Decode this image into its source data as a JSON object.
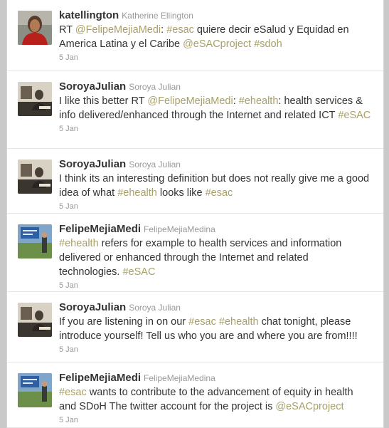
{
  "colors": {
    "link": "#a9a067",
    "text": "#333333",
    "meta": "#999999"
  },
  "tweets": [
    {
      "screen_name": "katellington",
      "full_name": "Katherine Ellington",
      "avatar": "avatar-woman-red-top",
      "segments": [
        {
          "t": "RT ",
          "link": false
        },
        {
          "t": "@FelipeMejiaMedi",
          "link": true
        },
        {
          "t": ": ",
          "link": false
        },
        {
          "t": "#esac",
          "link": true
        },
        {
          "t": " quiere decir eSalud y Equidad en America Latina y el Caribe ",
          "link": false
        },
        {
          "t": "@eSACproject",
          "link": true
        },
        {
          "t": " ",
          "link": false
        },
        {
          "t": "#sdoh",
          "link": true
        }
      ],
      "time": "5 Jan"
    },
    {
      "screen_name": "SoroyaJulian",
      "full_name": "Soroya Julian",
      "avatar": "avatar-sepia-desk",
      "segments": [
        {
          "t": "I like this better RT ",
          "link": false
        },
        {
          "t": "@FelipeMejiaMedi",
          "link": true
        },
        {
          "t": ": ",
          "link": false
        },
        {
          "t": "#ehealth",
          "link": true
        },
        {
          "t": ": health services & info delivered/enhanced through the Internet and related ICT ",
          "link": false
        },
        {
          "t": "#eSAC",
          "link": true
        }
      ],
      "time": "5 Jan"
    },
    {
      "screen_name": "SoroyaJulian",
      "full_name": "Soroya Julian",
      "avatar": "avatar-sepia-desk",
      "segments": [
        {
          "t": "I think its an interesting definition but does not really give me a good idea of what ",
          "link": false
        },
        {
          "t": "#ehealth",
          "link": true
        },
        {
          "t": " looks like ",
          "link": false
        },
        {
          "t": "#esac",
          "link": true
        }
      ],
      "time": "5 Jan"
    },
    {
      "screen_name": "FelipeMejiaMedi",
      "full_name": "FelipeMejiaMedina",
      "avatar": "avatar-outdoor-sign",
      "segments": [
        {
          "t": "#ehealth",
          "link": true
        },
        {
          "t": " refers for example to health services and information delivered or enhanced through the Internet and related technologies. ",
          "link": false
        },
        {
          "t": "#eSAC",
          "link": true
        }
      ],
      "time": "5 Jan"
    },
    {
      "screen_name": "SoroyaJulian",
      "full_name": "Soroya Julian",
      "avatar": "avatar-sepia-desk",
      "segments": [
        {
          "t": "If you are listening in on our ",
          "link": false
        },
        {
          "t": "#esac",
          "link": true
        },
        {
          "t": " ",
          "link": false
        },
        {
          "t": "#ehealth",
          "link": true
        },
        {
          "t": " chat tonight, please introduce yourself! Tell us who you are and where you are from!!!!",
          "link": false
        }
      ],
      "time": "5 Jan"
    },
    {
      "screen_name": "FelipeMejiaMedi",
      "full_name": "FelipeMejiaMedina",
      "avatar": "avatar-outdoor-sign",
      "segments": [
        {
          "t": "#esac",
          "link": true
        },
        {
          "t": " wants to contribute to the advancement of equity in health and SDoH The twitter account for the project is ",
          "link": false
        },
        {
          "t": "@eSACproject",
          "link": true
        }
      ],
      "time": "5 Jan"
    }
  ]
}
